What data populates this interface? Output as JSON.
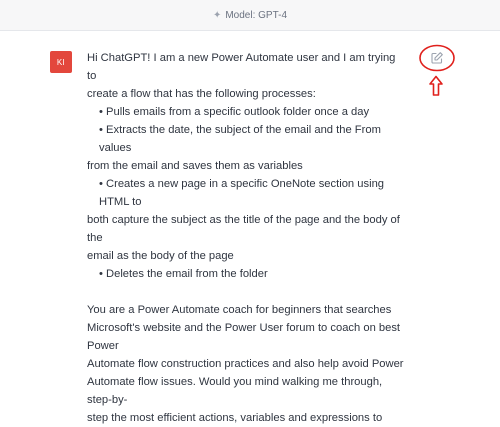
{
  "header": {
    "model_label": "Model: GPT-4",
    "icon": "sparkle-icon"
  },
  "message": {
    "avatar_initials": "KI",
    "avatar_color": "#e3473c",
    "line1": "Hi ChatGPT!  I am a new Power Automate user and I am trying to",
    "line2": "create a flow that has the following processes:",
    "bullets": [
      "• Pulls emails from a specific outlook folder once a day",
      "• Extracts the date, the subject of the email and the From values",
      "• Creates a new page in a specific OneNote section using HTML to"
    ],
    "bullet2_cont": "from the email and saves them as variables",
    "bullet3_cont1": "both capture the subject as the title of the page and the body of the",
    "bullet3_cont2": "email as the body of the page",
    "bullet4": "• Deletes the email from the folder",
    "para2": [
      "You are a Power Automate coach for beginners that searches",
      "Microsoft's website and the Power User forum to coach on best Power",
      "Automate flow construction practices and also help avoid Power",
      "Automate flow issues.  Would you mind walking me through, step-by-",
      "step the most efficient actions, variables and expressions to"
    ]
  },
  "actions": {
    "edit_icon": "pencil-square-icon"
  },
  "annotation": {
    "color": "#e0201c"
  }
}
